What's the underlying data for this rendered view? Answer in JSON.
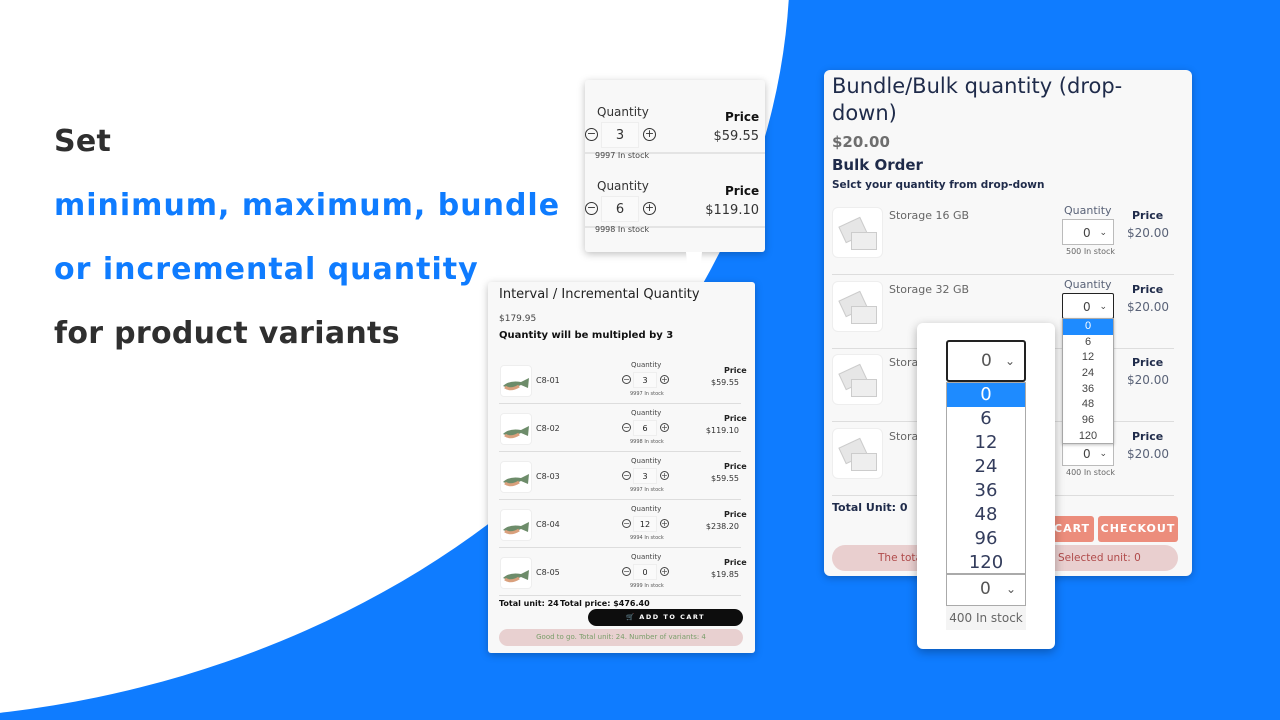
{
  "headline": {
    "line1": "Set",
    "line2": "minimum, maximum, bundle",
    "line3": "or incremental quantity",
    "line4": "for product variants",
    "accent_color": "#0f7cff"
  },
  "snippet": {
    "rows": [
      {
        "quantity_label": "Quantity",
        "value": "3",
        "stock": "9997 In stock",
        "price_label": "Price",
        "price": "$59.55"
      },
      {
        "quantity_label": "Quantity",
        "value": "6",
        "stock": "9998 In stock",
        "price_label": "Price",
        "price": "$119.10"
      }
    ]
  },
  "interval": {
    "title": "Interval / Incremental Quantity",
    "price": "$179.95",
    "subtitle": "Quantity will be multipled by 3",
    "rows": [
      {
        "name": "C8-01",
        "quantity_label": "Quantity",
        "value": "3",
        "stock": "9997 In stock",
        "price_label": "Price",
        "price": "$59.55"
      },
      {
        "name": "C8-02",
        "quantity_label": "Quantity",
        "value": "6",
        "stock": "9998 In stock",
        "price_label": "Price",
        "price": "$119.10"
      },
      {
        "name": "C8-03",
        "quantity_label": "Quantity",
        "value": "3",
        "stock": "9997 In stock",
        "price_label": "Price",
        "price": "$59.55"
      },
      {
        "name": "C8-04",
        "quantity_label": "Quantity",
        "value": "12",
        "stock": "9994 In stock",
        "price_label": "Price",
        "price": "$238.20"
      },
      {
        "name": "C8-05",
        "quantity_label": "Quantity",
        "value": "0",
        "stock": "9999 In stock",
        "price_label": "Price",
        "price": "$19.85"
      }
    ],
    "total_unit": "Total unit: 24",
    "total_price": "Total price:  $476.40",
    "add_to_cart": "ADD TO CART",
    "message": "Good to go. Total unit: 24. Number of variants: 4"
  },
  "bundle": {
    "title": "Bundle/Bulk quantity (drop-down)",
    "price": "$20.00",
    "subtitle": "Bulk Order",
    "instruction": "Selct your quantity from drop-down",
    "rows": [
      {
        "name": "Storage  16 GB",
        "quantity_label": "Quantity",
        "value": "0",
        "stock": "500 In stock",
        "price_label": "Price",
        "price": "$20.00"
      },
      {
        "name": "Storage  32 GB",
        "quantity_label": "Quantity",
        "value": "0",
        "stock": "",
        "price_label": "Price",
        "price": "$20.00"
      },
      {
        "name": "Storage",
        "quantity_label": "",
        "value": "",
        "stock": "",
        "price_label": "Price",
        "price": "$20.00"
      },
      {
        "name": "Storage",
        "quantity_label": "",
        "value": "0",
        "stock": "400 In stock",
        "price_label": "Price",
        "price": "$20.00"
      }
    ],
    "dropdown_options": [
      "0",
      "6",
      "12",
      "24",
      "36",
      "48",
      "96",
      "120"
    ],
    "selected_option": "0",
    "total_unit": "Total Unit: 0",
    "cart_label": "CART",
    "checkout_label": "CHECKOUT",
    "message_left": "The tota",
    "message_right": "Selected unit: 0",
    "button_color": "#ec8d7c"
  },
  "zoom_popup": {
    "selected": "0",
    "options": [
      "0",
      "6",
      "12",
      "24",
      "36",
      "48",
      "96",
      "120"
    ],
    "below_value": "0",
    "stock": "400 In stock"
  }
}
